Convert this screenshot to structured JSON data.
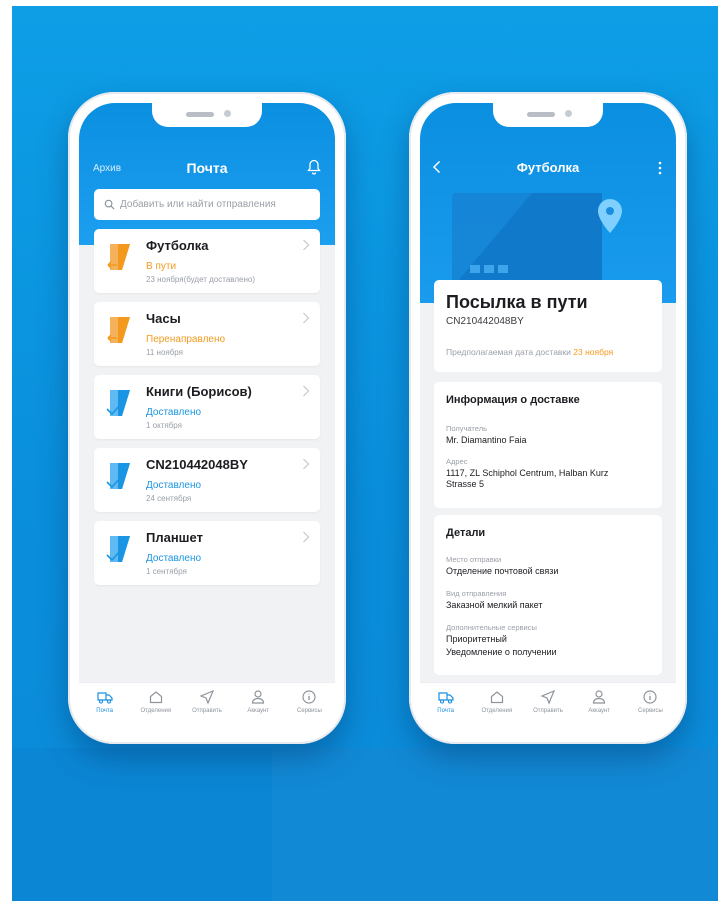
{
  "colors": {
    "brand": "#0b8fe0",
    "orange": "#f39a1e",
    "delivered": "#1a95e4"
  },
  "left": {
    "header": {
      "archive": "Архив",
      "title": "Почта",
      "bell_icon": "bell-icon"
    },
    "search": {
      "placeholder": "Добавить или найти отправления",
      "icon": "search-icon"
    },
    "items": [
      {
        "title": "Футболка",
        "status": "В пути",
        "date": "23 ноября(будет доставлено)",
        "state": "transit"
      },
      {
        "title": "Часы",
        "status": "Перенаправлено",
        "date": "11 ноября",
        "state": "transit"
      },
      {
        "title": "Книги (Борисов)",
        "status": "Доставлено",
        "date": "1 октября",
        "state": "delivered"
      },
      {
        "title": "CN210442048BY",
        "status": "Доставлено",
        "date": "24 сентября",
        "state": "delivered"
      },
      {
        "title": "Планшет",
        "status": "Доставлено",
        "date": "1 сентября",
        "state": "delivered"
      }
    ]
  },
  "tabs": [
    {
      "label": "Почта",
      "icon": "truck-icon",
      "active": true
    },
    {
      "label": "Отделения",
      "icon": "home-icon"
    },
    {
      "label": "Отправить",
      "icon": "send-icon"
    },
    {
      "label": "Аккаунт",
      "icon": "user-icon"
    },
    {
      "label": "Сервисы",
      "icon": "info-icon"
    }
  ],
  "right": {
    "header": {
      "title": "Футболка"
    },
    "status_card": {
      "heading": "Посылка в пути",
      "tracking": "CN210442048BY",
      "estimate_label": "Предполагаемая дата доставки",
      "estimate_date": "23 ноября"
    },
    "delivery": {
      "title": "Информация о доставке",
      "recipient_label": "Получатель",
      "recipient": "Mr. Diamantino Faia",
      "address_label": "Адрес",
      "address": "1117, ZL Schiphol Centrum, Halban Kurz Strasse 5"
    },
    "details": {
      "title": "Детали",
      "origin_label": "Место отправки",
      "origin": "Отделение почтовой связи",
      "type_label": "Вид отправления",
      "type": "Заказной мелкий пакет",
      "services_label": "Дополнительные сервисы",
      "service_1": "Приоритетный",
      "service_2": "Уведомление о получении"
    }
  }
}
